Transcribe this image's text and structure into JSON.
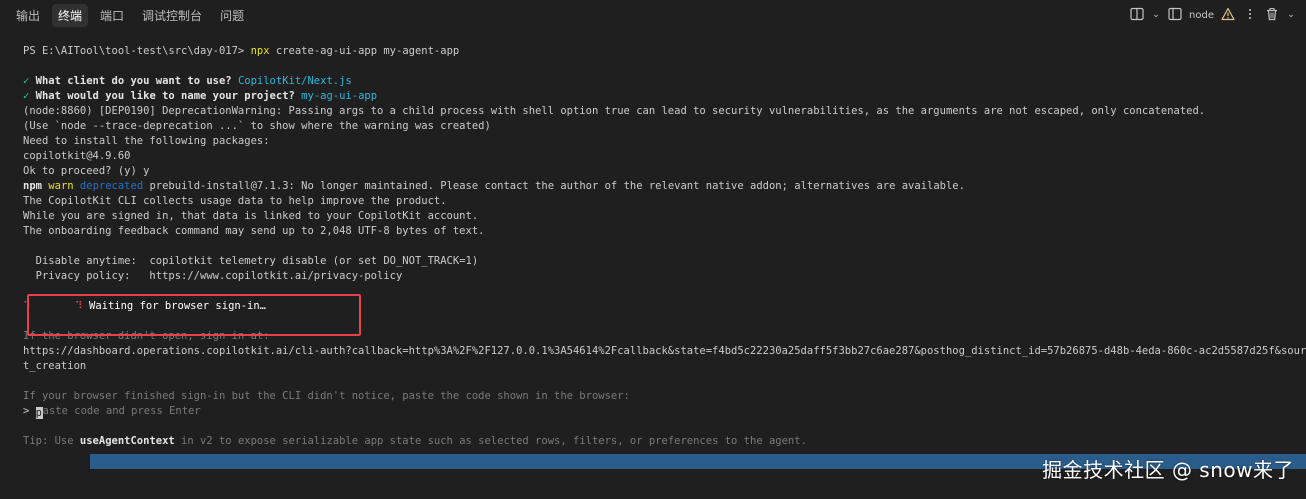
{
  "panel_tabs": [
    {
      "label": "输出"
    },
    {
      "label": "终端"
    },
    {
      "label": "端口"
    },
    {
      "label": "调试控制台"
    },
    {
      "label": "问题"
    }
  ],
  "active_tab": "终端",
  "toolbar": {
    "terminal_name": "node",
    "icons": [
      "split-layout-icon",
      "split-terminal-icon",
      "warning-icon",
      "more-icon",
      "trash-icon"
    ]
  },
  "terminal": {
    "prompt_path": "PS E:\\AITool\\tool-test\\src\\day-017>",
    "prompt_cmd": "npx",
    "prompt_args": " create-ag-ui-app my-agent-app",
    "q1_check": "✓",
    "q1_text": "What client do you want to use?",
    "q1_answer": "CopilotKit/Next.js",
    "q2_check": "✓",
    "q2_text": "What would you like to name your project?",
    "q2_answer": "my-ag-ui-app",
    "dep_warning": "(node:8860) [DEP0190] DeprecationWarning: Passing args to a child process with shell option true can lead to security vulnerabilities, as the arguments are not escaped, only concatenated.",
    "trace_hint": "(Use `node --trace-deprecation ...` to show where the warning was created)",
    "need_install": "Need to install the following packages:",
    "package": "copilotkit@4.9.60",
    "proceed": "Ok to proceed? (y) y",
    "npm_label": "npm",
    "npm_warn": "warn",
    "npm_deprecated": "deprecated",
    "npm_msg": " prebuild-install@7.1.3: No longer maintained. Please contact the author of the relevant native addon; alternatives are available.",
    "telemetry_1": "The CopilotKit CLI collects usage data to help improve the product.",
    "telemetry_2": "While you are signed in, that data is linked to your CopilotKit account.",
    "telemetry_3": "The onboarding feedback command may send up to 2,048 UTF-8 bytes of text.",
    "disable_label": "  Disable anytime:",
    "disable_value": "  copilotkit telemetry disable (or set DO_NOT_TRACK=1)",
    "privacy_label": "  Privacy policy:",
    "privacy_value": "   https://www.copilotkit.ai/privacy-policy",
    "waiting_spinner_1": "⠹",
    "waiting_spinner_2": "⠹",
    "waiting_text": "Waiting for browser sign-in…",
    "browser_hint": "If the browser didn't open, sign in at:",
    "auth_url": "https://dashboard.operations.copilotkit.ai/cli-auth?callback=http%3A%2F%2F127.0.0.1%3A54614%2Fcallback&state=f4bd5c22230a25daff5f3bb27c6ae287&posthog_distinct_id=57b26875-d48b-4eda-860c-ac2d5587d25f&source=cli&mode",
    "auth_url_cont": "t_creation",
    "paste_hint": "If your browser finished sign-in but the CLI didn't notice, paste the code shown in the browser:",
    "paste_prompt": "> ",
    "paste_cursor_char": "p",
    "paste_rest": "aste code and press Enter",
    "tip_prefix": "Tip: Use ",
    "tip_bold": "useAgentContext",
    "tip_rest": " in v2 to expose serializable app state such as selected rows, filters, or preferences to the agent."
  },
  "watermark": "掘金技术社区 @ snow来了",
  "colors": {
    "background": "#1f1f1f",
    "highlight_box": "#e8414a",
    "green_check": "#23d18b",
    "cyan_answer": "#29b8db",
    "command_yellow": "#e5e510"
  }
}
